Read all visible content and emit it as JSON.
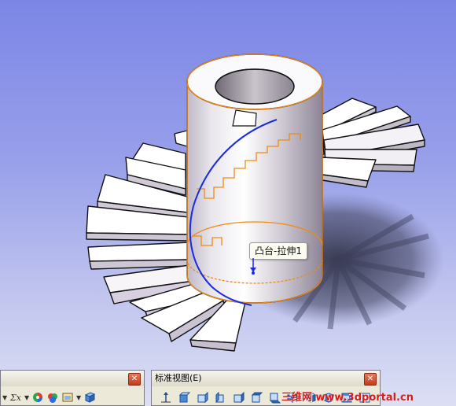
{
  "tooltip": {
    "feature_name": "凸台-拉伸1"
  },
  "toolbars": {
    "left": {
      "icons": [
        "dropdown-arrow-icon",
        "equation-icon",
        "dropdown-arrow-icon",
        "color-wheel-icon",
        "appearance-icon",
        "scene-icon",
        "dropdown-arrow-icon",
        "view-cube-icon"
      ],
      "close_glyph": "✕"
    },
    "right": {
      "title": "标准视图(E)",
      "close_glyph": "✕",
      "icons": [
        "normal-to-icon",
        "front-view-icon",
        "back-view-icon",
        "left-view-icon",
        "right-view-icon",
        "top-view-icon",
        "bottom-view-icon",
        "isometric-view-icon",
        "trimetric-view-icon",
        "dimetric-view-icon",
        "view-link-icon",
        "single-view-icon"
      ]
    }
  },
  "watermark": {
    "text": "三维网 www.3dportal.cn"
  },
  "colors": {
    "background_top": "#7c86e6",
    "background_bottom": "#dcdff3",
    "selection_edge": "#f08a10",
    "sketch_path": "#1a2be0",
    "watermark": "#d41d1d"
  }
}
